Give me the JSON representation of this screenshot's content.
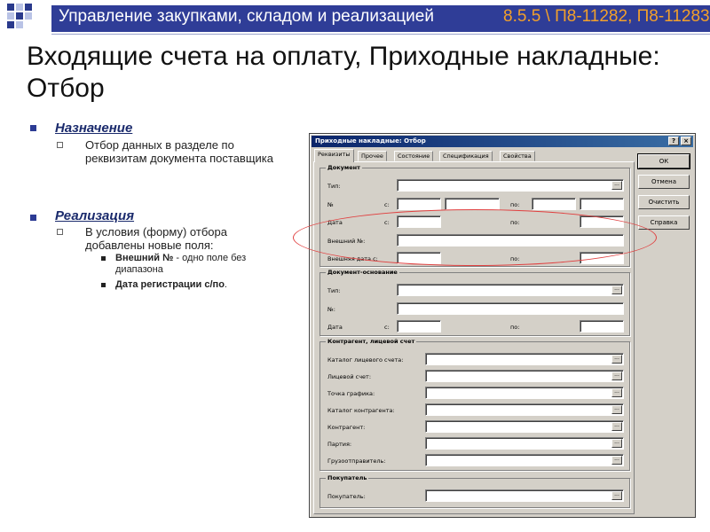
{
  "header": {
    "title": "Управление закупками, складом и реализацией",
    "code": "8.5.5 \\ П8-11282, П8-11283"
  },
  "slide": {
    "title": "Входящие счета на оплату, Приходные накладные: Отбор"
  },
  "bullets": {
    "purpose_heading": "Назначение",
    "purpose_text": "Отбор данных в разделе по реквизитам документа поставщика",
    "impl_heading": "Реализация",
    "impl_text": "В условия (форму) отбора добавлены новые поля:",
    "sub1_bold": "Внешний №",
    "sub1_rest": " - одно поле без диапазона",
    "sub2_bold": "Дата регистрации с/по",
    "sub2_rest": "."
  },
  "dialog": {
    "title": "Приходные накладные: Отбор",
    "help_btn": "?",
    "close_btn": "×",
    "tabs": [
      "Реквизиты",
      "Прочее",
      "Состояние",
      "Спецификация",
      "Свойства"
    ],
    "buttons": {
      "ok": "ОК",
      "cancel": "Отмена",
      "clear": "Очистить",
      "help": "Справка"
    },
    "dots": "...",
    "groups": {
      "document": "Документ",
      "basis": "Документ-основание",
      "counterparty": "Контрагент, лицевой счет",
      "buyer": "Покупатель"
    },
    "labels": {
      "type": "Тип:",
      "number": "№",
      "date": "Дата",
      "from": "с:",
      "to": "по:",
      "ext_number": "Внешний №:",
      "ext_date_from": "Внешняя дата с:",
      "basis_type": "Тип:",
      "basis_number": "№:",
      "basis_date": "Дата",
      "account_catalog": "Каталог лицевого счета:",
      "account": "Лицевой счет:",
      "schedule_point": "Точка графика:",
      "counterparty_catalog": "Каталог контрагента:",
      "counterparty": "Контрагент:",
      "batch": "Партия:",
      "shipper": "Грузоотправитель:",
      "buyer": "Покупатель:"
    }
  }
}
